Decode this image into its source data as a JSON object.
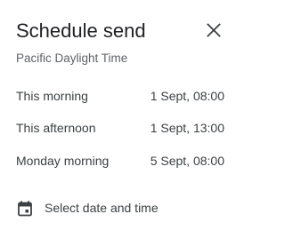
{
  "dialog": {
    "title": "Schedule send",
    "close_icon": "close-icon",
    "timezone": "Pacific Daylight Time"
  },
  "options": [
    {
      "label": "This morning",
      "time": "1 Sept, 08:00"
    },
    {
      "label": "This afternoon",
      "time": "1 Sept, 13:00"
    },
    {
      "label": "Monday morning",
      "time": "5 Sept, 08:00"
    }
  ],
  "custom": {
    "icon": "calendar-icon",
    "label": "Select date and time"
  },
  "colors": {
    "title": "#202124",
    "text": "#3c4043",
    "secondary": "#5f6368"
  }
}
